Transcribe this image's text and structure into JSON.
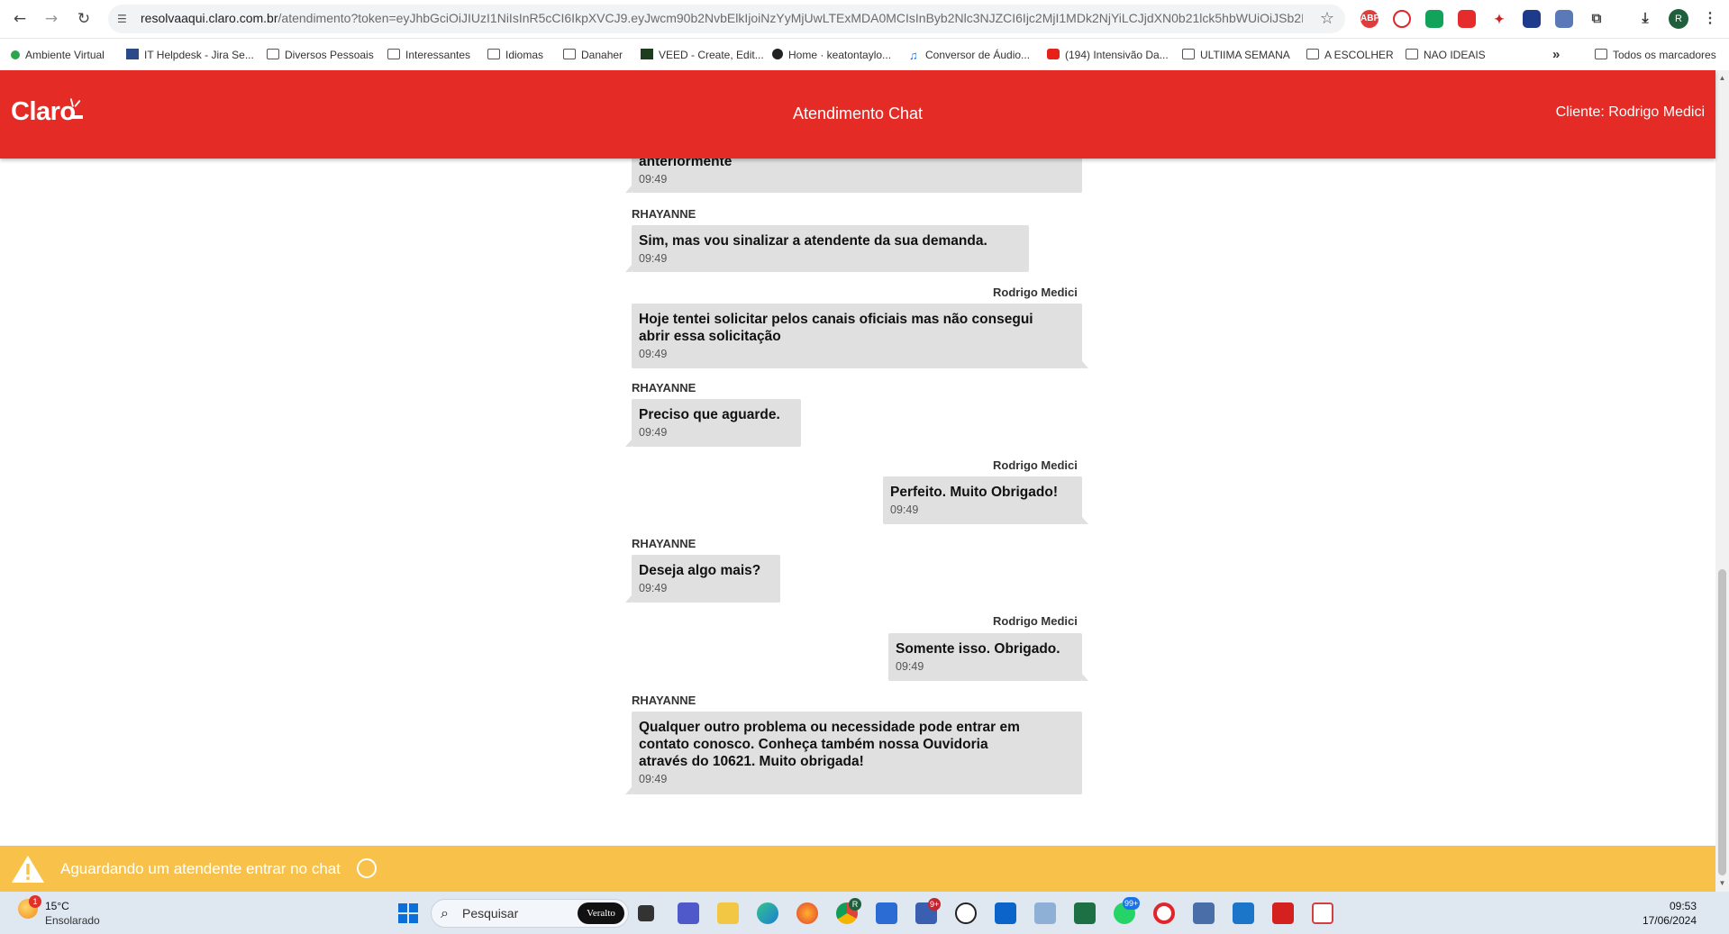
{
  "browser": {
    "url_host": "resolvaaqui.claro.com.br",
    "url_path": "/atendimento?token=eyJhbGciOiJIUzI1NiIsInR5cCI6IkpXVCJ9.eyJwcm90b2NvbElkIjoiNzYyMjUwLTExMDA0MCIsInByb2Nlc3NJZCI6Ijc2MjI1MDk2NjYiLCJjdXN0b21lck5hbWUiOiJSb2RyaWd...",
    "profile_initial": "R"
  },
  "bookmarks": [
    {
      "label": "Ambiente Virtual",
      "icon": "leaf-icon"
    },
    {
      "label": "IT Helpdesk - Jira Se...",
      "icon": "jira-icon"
    },
    {
      "label": "Diversos Pessoais",
      "icon": "folder-icon"
    },
    {
      "label": "Interessantes",
      "icon": "folder-icon"
    },
    {
      "label": "Idiomas",
      "icon": "folder-icon"
    },
    {
      "label": "Danaher",
      "icon": "folder-icon"
    },
    {
      "label": "VEED - Create, Edit...",
      "icon": "veed-icon"
    },
    {
      "label": "Home · keatontaylo...",
      "icon": "github-icon"
    },
    {
      "label": "Conversor de Áudio...",
      "icon": "music-icon"
    },
    {
      "label": "(194) Intensivão Da...",
      "icon": "youtube-icon"
    },
    {
      "label": "ULTIIMA SEMANA",
      "icon": "folder-icon"
    },
    {
      "label": "A ESCOLHER",
      "icon": "folder-icon"
    },
    {
      "label": "NAO IDEAIS",
      "icon": "folder-icon"
    }
  ],
  "bookmarks_more": "»",
  "bookmarks_all": "Todos os marcadores",
  "header": {
    "logo": "Claro",
    "title": "Atendimento Chat",
    "client": "Cliente: Rodrigo Medici"
  },
  "messages": [
    {
      "sender": "",
      "side": "left",
      "text": "anteriormente",
      "time": "09:49"
    },
    {
      "sender": "RHAYANNE",
      "side": "left",
      "text": "Sim, mas vou sinalizar a atendente da sua demanda.",
      "time": "09:49"
    },
    {
      "sender": "Rodrigo Medici",
      "side": "right",
      "text": "Hoje tentei solicitar pelos canais oficiais mas não consegui\nabrir essa solicitação",
      "time": "09:49"
    },
    {
      "sender": "RHAYANNE",
      "side": "left",
      "text": "Preciso que aguarde.",
      "time": "09:49"
    },
    {
      "sender": "Rodrigo Medici",
      "side": "right",
      "text": "Perfeito. Muito Obrigado!",
      "time": "09:49"
    },
    {
      "sender": "RHAYANNE",
      "side": "left",
      "text": "Deseja algo mais?",
      "time": "09:49"
    },
    {
      "sender": "Rodrigo Medici",
      "side": "right",
      "text": "Somente isso. Obrigado.",
      "time": "09:49"
    },
    {
      "sender": "RHAYANNE",
      "side": "left",
      "text": "Qualquer outro problema ou necessidade pode entrar em\ncontato conosco. Conheça também nossa Ouvidoria\natravés do 10621. Muito obrigada!",
      "time": "09:49"
    }
  ],
  "status": {
    "text": "Aguardando um atendente entrar no chat",
    "color": "#f8c24a"
  },
  "taskbar": {
    "weather_temp": "15°C",
    "weather_desc": "Ensolarado",
    "weather_badge": "1",
    "search_placeholder": "Pesquisar",
    "search_brand": "Veralto",
    "teams_badge": "9+",
    "whatsapp_badge": "99+",
    "chrome_badge": "R",
    "time": "09:53",
    "date": "17/06/2024"
  },
  "colors": {
    "brand_red": "#e42b26",
    "bubble": "#e0e0e0",
    "status_yellow": "#f8c24a"
  }
}
